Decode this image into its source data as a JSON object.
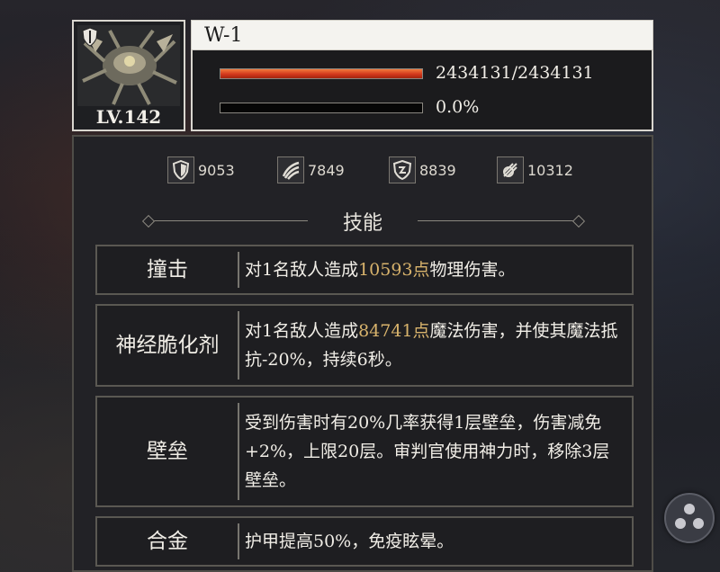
{
  "unit": {
    "name": "W-1",
    "level": "LV.142",
    "hp_text": "2434131/2434131",
    "hp_fraction": 1.0,
    "energy_text": "0.0%",
    "energy_fraction": 0.0
  },
  "stats": [
    {
      "icon": "shield-icon",
      "value": "9053"
    },
    {
      "icon": "claw-slash-icon",
      "value": "7849"
    },
    {
      "icon": "magic-shield-icon",
      "value": "8839"
    },
    {
      "icon": "swirl-attack-icon",
      "value": "10312"
    }
  ],
  "skills_title": "技能",
  "skills": [
    {
      "name": "撞击",
      "desc_before": "对1名敌人造成",
      "highlight": "10593点",
      "desc_after": "物理伤害。"
    },
    {
      "name": "神经脆化剂",
      "desc_before": "对1名敌人造成",
      "highlight": "84741点",
      "desc_after": "魔法伤害，并使其魔法抵抗-20%，持续6秒。"
    },
    {
      "name": "壁垒",
      "desc_before": "受到伤害时有20%几率获得1层壁垒，伤害减免+2%，上限20层。审判官使用神力时，移除3层壁垒。",
      "highlight": "",
      "desc_after": ""
    },
    {
      "name": "合金",
      "desc_before": "护甲提高50%，免疫眩晕。",
      "highlight": "",
      "desc_after": ""
    }
  ],
  "colors": {
    "highlight": "#d8b36c",
    "hp_bar": "#d4381c",
    "panel": "#222226"
  }
}
